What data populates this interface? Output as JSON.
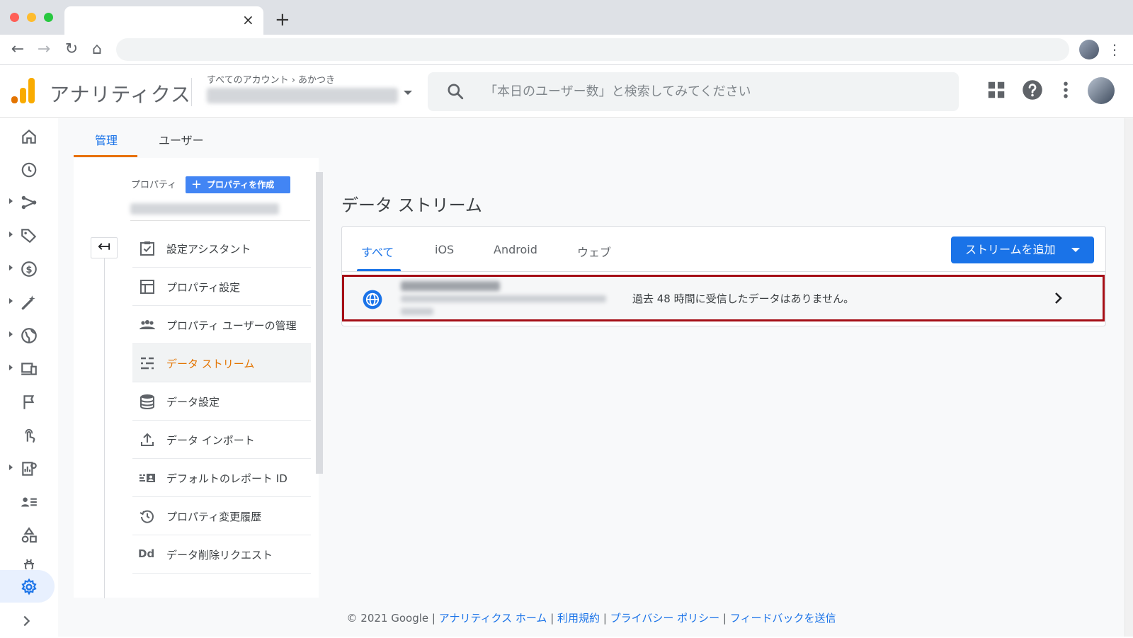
{
  "browser": {
    "tab_close_glyph": "×",
    "tab_new_glyph": "+",
    "nav": {
      "back_glyph": "←",
      "forward_glyph": "→",
      "reload_glyph": "↻",
      "home_glyph": "⌂",
      "menu_glyph": "⋮"
    }
  },
  "header": {
    "app_title": "アナリティクス",
    "breadcrumb": "すべてのアカウント › あかつき",
    "search_placeholder": "「本日のユーザー数」と検索してみてください",
    "colors": {
      "logo_orange": "#f9ab00",
      "logo_dark_orange": "#e37400"
    }
  },
  "rail": {
    "icons": [
      "home-icon",
      "clock-icon",
      "flow-icon",
      "tag-icon",
      "dollar-icon",
      "wand-icon",
      "globe-icon",
      "devices-icon",
      "flag-icon",
      "touch-icon",
      "report-icon",
      "user-list-icon",
      "shapes-icon",
      "bug-icon",
      "gear-icon",
      "expand-chevron-icon"
    ]
  },
  "admin_tabs": {
    "admin": "管理",
    "user": "ユーザー"
  },
  "property": {
    "label": "プロパティ",
    "create_button": "プロパティを作成",
    "back_glyph": "↤",
    "menu": [
      {
        "label": "設定アシスタント",
        "icon": "checklist-icon"
      },
      {
        "label": "プロパティ設定",
        "icon": "layout-icon"
      },
      {
        "label": "プロパティ ユーザーの管理",
        "icon": "people-icon"
      },
      {
        "label": "データ ストリーム",
        "icon": "streams-icon",
        "active": true
      },
      {
        "label": "データ設定",
        "icon": "database-icon"
      },
      {
        "label": "データ インポート",
        "icon": "upload-icon"
      },
      {
        "label": "デフォルトのレポート ID",
        "icon": "report-id-icon"
      },
      {
        "label": "プロパティ変更履歴",
        "icon": "history-icon"
      },
      {
        "label": "データ削除リクエスト",
        "icon": "dd-icon",
        "icon_text": "Dd"
      }
    ]
  },
  "main": {
    "title": "データ ストリーム",
    "tabs": {
      "all": "すべて",
      "ios": "iOS",
      "android": "Android",
      "web": "ウェブ"
    },
    "add_stream_button": "ストリームを追加",
    "stream_row": {
      "status": "過去 48 時間に受信したデータはありません。"
    },
    "colors": {
      "highlight_border": "#a50e16",
      "accent": "#1a73e8"
    }
  },
  "footer": {
    "copyright": "© 2021 Google |",
    "links": [
      "アナリティクス ホーム",
      "利用規約",
      "プライバシー ポリシー",
      "フィードバックを送信"
    ],
    "sep": " | "
  }
}
